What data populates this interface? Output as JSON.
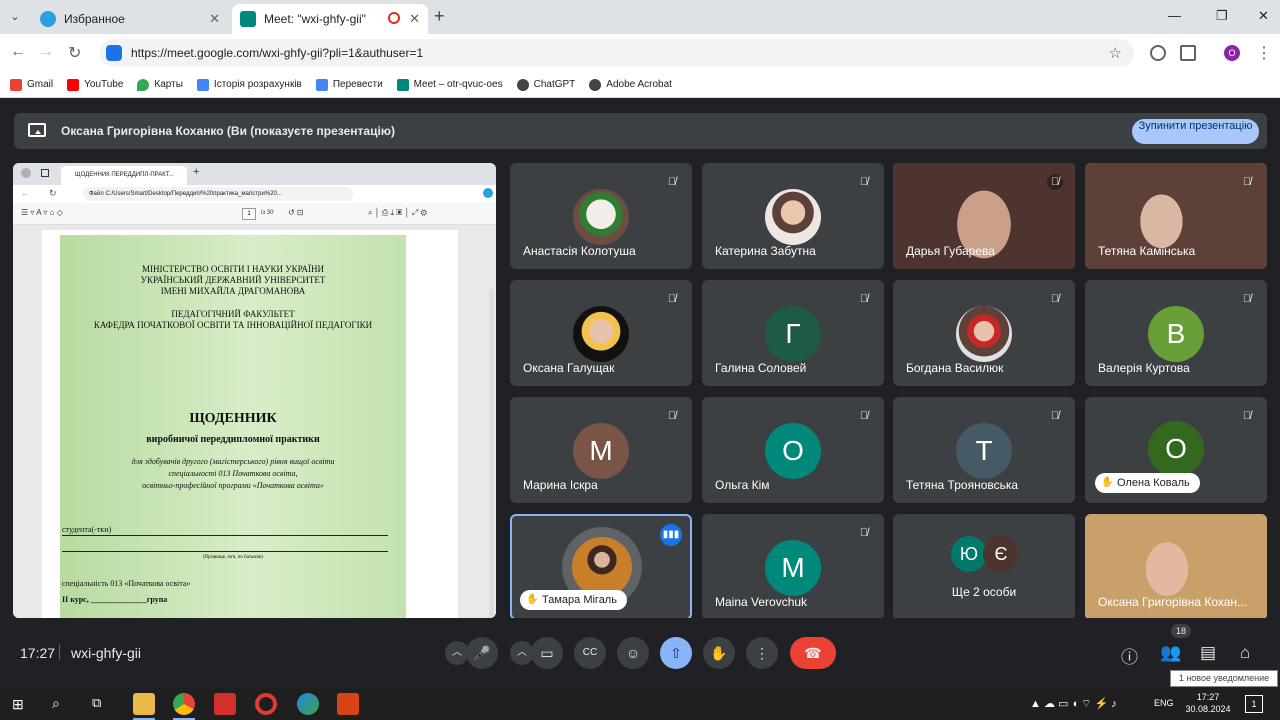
{
  "browser": {
    "tabs": [
      {
        "title": "Избранное"
      },
      {
        "title": "Meet: \"wxi-ghfy-gii\""
      }
    ],
    "url": "https://meet.google.com/wxi-ghfy-gii?pli=1&authuser=1",
    "profile_initial": "O",
    "bookmarks": [
      {
        "label": "Gmail",
        "color": "#ea4335"
      },
      {
        "label": "YouTube",
        "color": "#ff0000"
      },
      {
        "label": "Карты",
        "color": "#34a853"
      },
      {
        "label": "Історія розрахунків",
        "color": "#4285f4"
      },
      {
        "label": "Перевести",
        "color": "#4285f4"
      },
      {
        "label": "Meet – otr-qvuc-oes",
        "color": "#00897b"
      },
      {
        "label": "ChatGPT",
        "color": "#444444"
      },
      {
        "label": "Adobe Acrobat",
        "color": "#444444"
      }
    ]
  },
  "meet": {
    "presenting_text": "Оксана Григорівна Коханко (Ви (показуєте презентацію)",
    "stop_button": "Зупинити презентацію",
    "shared_screen": {
      "tab_title": "ЩОДЕННИК ПЕРЕДДИПЛ-ПРАКТ...",
      "file_label": "Файл",
      "path": "C:/Users/Smart/Desktop/Переддип/%20практика_магістри%20...",
      "page_number": "1",
      "page_total": "із 30",
      "doc": {
        "ministry": "МІНІСТЕРСТВО ОСВІТИ І НАУКИ УКРАЇНИ",
        "university1": "УКРАЇНСЬКИЙ ДЕРЖАВНИЙ УНІВЕРСИТЕТ",
        "university2": "ІМЕНІ МИХАЙЛА ДРАГОМАНОВА",
        "faculty": "ПЕДАГОГІЧНИЙ ФАКУЛЬТЕТ",
        "department": "КАФЕДРА ПОЧАТКОВОЇ ОСВІТИ ТА ІННОВАЦІЙНОЇ ПЕДАГОГІКИ",
        "title": "ЩОДЕННИК",
        "subtitle": "виробничої переддипломної практики",
        "desc1": "для здобувачів другого (магістерського) рівня вищої освіти",
        "desc2": "спеціальності 013 Початкова освіта,",
        "desc3": "освітньо-професійної програми «Початкова освіта»",
        "student_label": "студента(-тки)",
        "name_hint": "(Прізвище, ім'я, по батькові)",
        "speciality": "спеціальність 013 «Початкова освіта»",
        "course": "II курс, ______________група"
      }
    },
    "participants": [
      {
        "name": "Анастасія Колотуша"
      },
      {
        "name": "Катерина Забутна"
      },
      {
        "name": "Дарья Губарева"
      },
      {
        "name": "Тетяна Камінська"
      },
      {
        "name": "Оксана Галущак"
      },
      {
        "name": "Галина Соловей",
        "initial": "Г",
        "color": "#1e5b45"
      },
      {
        "name": "Богдана Василюк"
      },
      {
        "name": "Валерія Куртова",
        "initial": "В",
        "color": "#689f38"
      },
      {
        "name": "Марина Іскра",
        "initial": "М",
        "color": "#795548"
      },
      {
        "name": "Ольга Кім",
        "initial": "О",
        "color": "#00897b"
      },
      {
        "name": "Тетяна Трояновська",
        "initial": "Т",
        "color": "#455a64"
      },
      {
        "name": "Олена Коваль",
        "initial": "О",
        "color": "#33691e"
      },
      {
        "name": "Тамара Мігаль"
      },
      {
        "name": "Maina Verovchuk",
        "initial": "M",
        "color": "#00897b"
      },
      {
        "name": "Ще 2 особи",
        "initial_a": "Ю",
        "initial_b": "Є",
        "color_a": "#00796b",
        "color_b": "#4e342e"
      },
      {
        "name": "Оксана Григорівна Кохан..."
      }
    ],
    "time": "17:27",
    "meeting_code": "wxi-ghfy-gii",
    "participant_count": "18",
    "notification": "1 новое уведомление"
  },
  "taskbar": {
    "lang": "ENG",
    "time": "17:27",
    "date": "30.08.2024",
    "notif_count": "1"
  }
}
